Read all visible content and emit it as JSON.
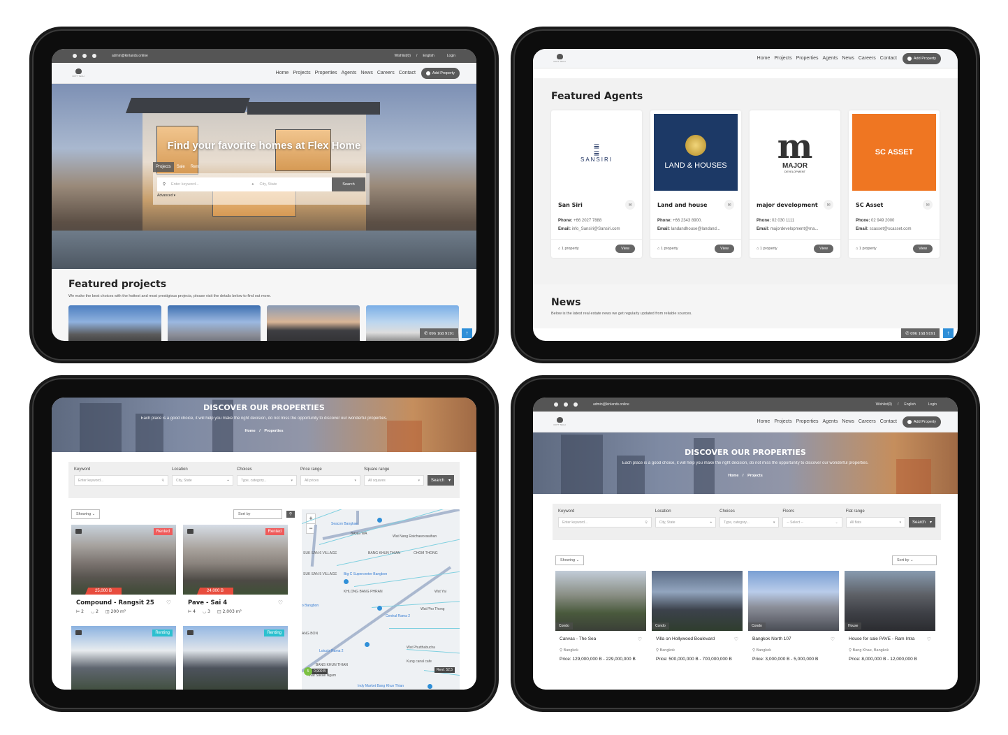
{
  "common": {
    "email": "admin@kinlands.online",
    "wishlist": "Wishlist(0)",
    "separator": "/",
    "language": "English",
    "login": "Login",
    "logo_text": "DOTT TECH",
    "nav": [
      "Home",
      "Projects",
      "Properties",
      "Agents",
      "News",
      "Careers",
      "Contact"
    ],
    "add_property": "Add Property",
    "phone": "096 168 9191",
    "up_arrow": "↑"
  },
  "screen1": {
    "hero_title": "Find your favorite homes at Flex Home",
    "tabs": [
      "Projects",
      "Sale",
      "Rent"
    ],
    "keyword_placeholder": "Enter keyword...",
    "location_placeholder": "City, State",
    "search_label": "Search",
    "advanced_label": "Advanced ▾",
    "featured_title": "Featured projects",
    "featured_desc": "We make the best choices with the hottest and most prestigious projects, please visit the details below to find out more."
  },
  "screen2": {
    "agents_title": "Featured Agents",
    "agents": [
      {
        "logo": "SANSIRI",
        "name": "San Siri",
        "phone": "+66 2027 7888",
        "email": "info_Sansiri@Sansiri.com",
        "count": "1 property",
        "logo_bg": "#ffffff",
        "logo_color": "#1d3160"
      },
      {
        "logo": "LAND & HOUSES",
        "name": "Land and house",
        "phone": "+66 2343 8900.",
        "email": "landandhouse@landand...",
        "count": "1 property",
        "logo_bg": "#1c3966",
        "logo_color": "#ffffff"
      },
      {
        "logo": "MAJOR",
        "logo_sub": "DEVELOPMENT",
        "name": "major development",
        "phone": "02 030 1111",
        "email": "majordevelopment@ma...",
        "count": "1 property",
        "logo_bg": "#ffffff",
        "logo_color": "#333333"
      },
      {
        "logo": "SC ASSET",
        "name": "SC Asset",
        "phone": "02 949 2000",
        "email": "scasset@scasset.com",
        "count": "1 property",
        "logo_bg": "#ef7622",
        "logo_color": "#ffffff"
      }
    ],
    "phone_label": "Phone:",
    "email_label": "Email:",
    "view_label": "View",
    "news_title": "News",
    "news_desc": "Below is the latest real estate news we get regularly updated from reliable sources."
  },
  "screen3": {
    "title": "DISCOVER OUR PROPERTIES",
    "subtitle": "Each place is a good choice, it will help you make the right decision, do not miss the opportunity to discover our wonderful properties.",
    "breadcrumb": [
      "Home",
      "/",
      "Properties"
    ],
    "filters": [
      {
        "label": "Keyword",
        "value": "Enter keyword..."
      },
      {
        "label": "Location",
        "value": "City, State"
      },
      {
        "label": "Choices",
        "value": "Type, category..."
      },
      {
        "label": "Price range",
        "value": "All prices"
      },
      {
        "label": "Square range",
        "value": "All squares"
      }
    ],
    "search_label": "Search",
    "showing_label": "Showing",
    "sort_label": "Sort by",
    "properties": [
      {
        "name": "Compound - Rangsit 25",
        "status": "Rented",
        "status_color": "#ef5a5a",
        "price": "25,000 B",
        "photos": "5",
        "beds": "2",
        "baths": "2",
        "area": "200 m²"
      },
      {
        "name": "Pave - Sai 4",
        "status": "Rented",
        "status_color": "#ef5a5a",
        "price": "24,000 B",
        "photos": "4",
        "beds": "4",
        "baths": "3",
        "area": "2,003 m²"
      },
      {
        "name": "",
        "status": "Renting",
        "status_color": "#2bc0cf",
        "photos": "4"
      },
      {
        "name": "",
        "status": "Renting",
        "status_color": "#2bc0cf",
        "photos": "4"
      }
    ],
    "map_labels": [
      "Seacon Bangkae",
      "BANG WA",
      "Wat Nang Ratchaworawihan",
      "CHOM THONG",
      "SUK SAN 6 VILLAGE",
      "SUK SAN 5 VILLAGE",
      "BANG KHUN THIAN",
      "Big C Supercenter Bangbon",
      "KHLONG BANG PHRAN",
      "Wat Yai",
      "o Bangbon",
      "Wat Pho Thong",
      "Central Rama 2",
      "ANG BON",
      "Wat Phutthabucha",
      "Lotus's Rama 2",
      "Kung canal cafe",
      "BANG KHUN THIAN",
      "Wat Sakae Ngam",
      "Indy Market Bang Khun Thian",
      "Rent: 52,5",
      "0,900 B",
      "5"
    ],
    "zoom_in": "+",
    "zoom_out": "−"
  },
  "screen4": {
    "title": "DISCOVER OUR PROPERTIES",
    "subtitle": "Each place is a good choice, it will help you make the right decision, do not miss the opportunity to discover our wonderful properties.",
    "breadcrumb": [
      "Home",
      "/",
      "Projects"
    ],
    "filters": [
      {
        "label": "Keyword",
        "value": "Enter keyword..."
      },
      {
        "label": "Location",
        "value": "City, State"
      },
      {
        "label": "Choices",
        "value": "Type, category..."
      },
      {
        "label": "Floors",
        "value": "-- Select --"
      },
      {
        "label": "Flat range",
        "value": "All flats"
      }
    ],
    "search_label": "Search",
    "showing_label": "Showing",
    "sort_label": "Sort by",
    "projects": [
      {
        "tag": "Condo",
        "name": "Canvas - The Sea",
        "location": "Bangkok",
        "price": "Price: 129,000,000 B - 229,000,000 B"
      },
      {
        "tag": "Condo",
        "name": "Villa on Hollywood Boulevard",
        "location": "Bangkok",
        "price": "Price: 500,000,000 B - 700,000,000 B"
      },
      {
        "tag": "Condo",
        "name": "Bangkok North 107",
        "location": "Bangkok",
        "price": "Price: 3,000,000 B - 5,000,000 B"
      },
      {
        "tag": "House",
        "name": "House for sale PAVE - Ram Intra",
        "location": "Bang Khae, Bangkok",
        "price": "Price: 8,000,000 B - 12,000,000 B"
      }
    ]
  }
}
